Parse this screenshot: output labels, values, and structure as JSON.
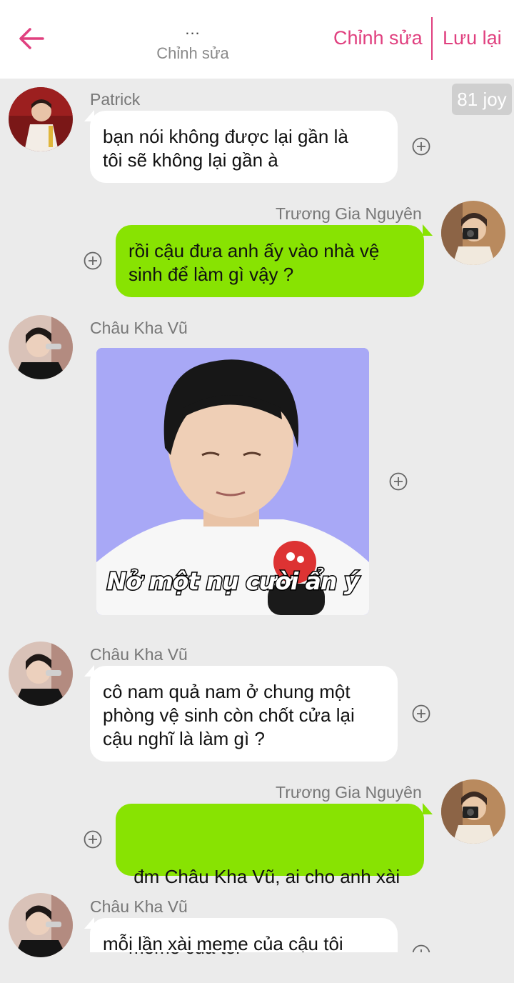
{
  "header": {
    "dots": "...",
    "subtitle": "Chỉnh sửa",
    "edit_label": "Chỉnh sửa",
    "save_label": "Lưu lại",
    "accent": "#e0407f"
  },
  "badge": "81 joy",
  "messages": [
    {
      "sender": "Patrick",
      "side": "left",
      "text_lines": [
        "bạn nói không được lại gần là",
        "tôi sẽ không lại gần à"
      ]
    },
    {
      "sender": "Trương Gia Nguyên",
      "side": "right",
      "text_lines": [
        "rồi cậu đưa anh ấy vào nhà vệ",
        "sinh để làm gì vậy ?"
      ]
    },
    {
      "sender": "Châu Kha Vũ",
      "side": "left",
      "image_caption": "Nở một nụ cười ẩn ý"
    },
    {
      "sender": "Châu Kha Vũ",
      "side": "left",
      "text_lines": [
        "cô nam quả nam ở chung một",
        "phòng vệ sinh còn chốt cửa lại",
        "cậu nghĩ là làm gì ?"
      ]
    },
    {
      "sender": "Trương Gia Nguyên",
      "side": "right",
      "text_lines": [
        " đm Châu Kha Vũ, ai cho anh xài",
        "meme của tôi"
      ]
    },
    {
      "sender": "Châu Kha Vũ",
      "side": "left",
      "text_lines": [
        "mỗi lần xài meme của cậu tôi"
      ]
    }
  ],
  "colors": {
    "background": "#ebebeb",
    "bubble_white": "#ffffff",
    "bubble_green": "#88e302",
    "name_text": "#777777"
  },
  "icons": {
    "back": "arrow-left-icon",
    "add": "plus-circle-icon"
  }
}
